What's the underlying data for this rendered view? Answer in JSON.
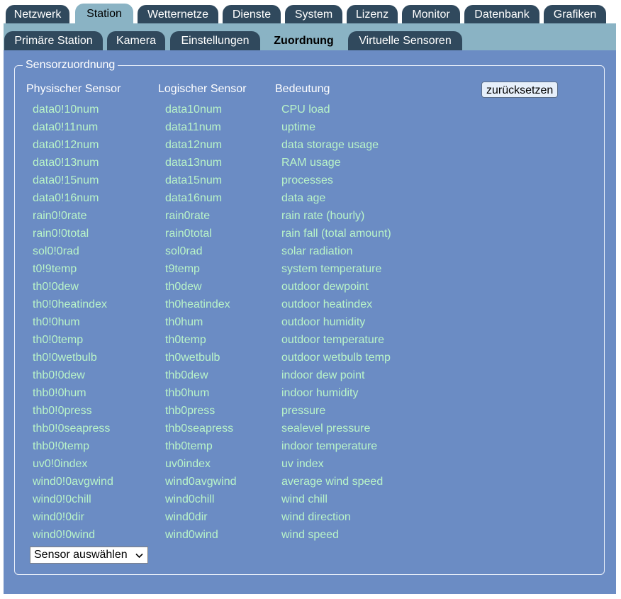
{
  "top_tabs": [
    {
      "label": "Netzwerk",
      "active": false
    },
    {
      "label": "Station",
      "active": true
    },
    {
      "label": "Wetternetze",
      "active": false
    },
    {
      "label": "Dienste",
      "active": false
    },
    {
      "label": "System",
      "active": false
    },
    {
      "label": "Lizenz",
      "active": false
    },
    {
      "label": "Monitor",
      "active": false
    },
    {
      "label": "Datenbank",
      "active": false
    },
    {
      "label": "Grafiken",
      "active": false
    }
  ],
  "sub_tabs": [
    {
      "label": "Primäre Station",
      "active": false
    },
    {
      "label": "Kamera",
      "active": false
    },
    {
      "label": "Einstellungen",
      "active": false
    },
    {
      "label": "Zuordnung",
      "active": true
    },
    {
      "label": "Virtuelle Sensoren",
      "active": false
    }
  ],
  "fieldset": {
    "legend": "Sensorzuordnung",
    "columns": {
      "physical": "Physischer Sensor",
      "logical": "Logischer Sensor",
      "meaning": "Bedeutung"
    },
    "reset_label": "zurücksetzen",
    "rows": [
      {
        "physical": "data0!10num",
        "logical": "data10num",
        "meaning": "CPU load"
      },
      {
        "physical": "data0!11num",
        "logical": "data11num",
        "meaning": "uptime"
      },
      {
        "physical": "data0!12num",
        "logical": "data12num",
        "meaning": "data storage usage"
      },
      {
        "physical": "data0!13num",
        "logical": "data13num",
        "meaning": "RAM usage"
      },
      {
        "physical": "data0!15num",
        "logical": "data15num",
        "meaning": "processes"
      },
      {
        "physical": "data0!16num",
        "logical": "data16num",
        "meaning": "data age"
      },
      {
        "physical": "rain0!0rate",
        "logical": "rain0rate",
        "meaning": "rain rate (hourly)"
      },
      {
        "physical": "rain0!0total",
        "logical": "rain0total",
        "meaning": "rain fall (total amount)"
      },
      {
        "physical": "sol0!0rad",
        "logical": "sol0rad",
        "meaning": "solar radiation"
      },
      {
        "physical": "t0!9temp",
        "logical": "t9temp",
        "meaning": "system temperature"
      },
      {
        "physical": "th0!0dew",
        "logical": "th0dew",
        "meaning": "outdoor dewpoint"
      },
      {
        "physical": "th0!0heatindex",
        "logical": "th0heatindex",
        "meaning": "outdoor heatindex"
      },
      {
        "physical": "th0!0hum",
        "logical": "th0hum",
        "meaning": "outdoor humidity"
      },
      {
        "physical": "th0!0temp",
        "logical": "th0temp",
        "meaning": "outdoor temperature"
      },
      {
        "physical": "th0!0wetbulb",
        "logical": "th0wetbulb",
        "meaning": "outdoor wetbulb temp"
      },
      {
        "physical": "thb0!0dew",
        "logical": "thb0dew",
        "meaning": "indoor dew point"
      },
      {
        "physical": "thb0!0hum",
        "logical": "thb0hum",
        "meaning": "indoor humidity"
      },
      {
        "physical": "thb0!0press",
        "logical": "thb0press",
        "meaning": "pressure"
      },
      {
        "physical": "thb0!0seapress",
        "logical": "thb0seapress",
        "meaning": "sealevel pressure"
      },
      {
        "physical": "thb0!0temp",
        "logical": "thb0temp",
        "meaning": "indoor temperature"
      },
      {
        "physical": "uv0!0index",
        "logical": "uv0index",
        "meaning": "uv index"
      },
      {
        "physical": "wind0!0avgwind",
        "logical": "wind0avgwind",
        "meaning": "average wind speed"
      },
      {
        "physical": "wind0!0chill",
        "logical": "wind0chill",
        "meaning": "wind chill"
      },
      {
        "physical": "wind0!0dir",
        "logical": "wind0dir",
        "meaning": "wind direction"
      },
      {
        "physical": "wind0!0wind",
        "logical": "wind0wind",
        "meaning": "wind speed"
      }
    ],
    "select_value": "Sensor auswählen"
  },
  "colors": {
    "tab_dark": "#30495d",
    "tab_light": "#8ab3c4",
    "panel": "#6b8cc4",
    "entry_text": "#b9f4c8"
  }
}
